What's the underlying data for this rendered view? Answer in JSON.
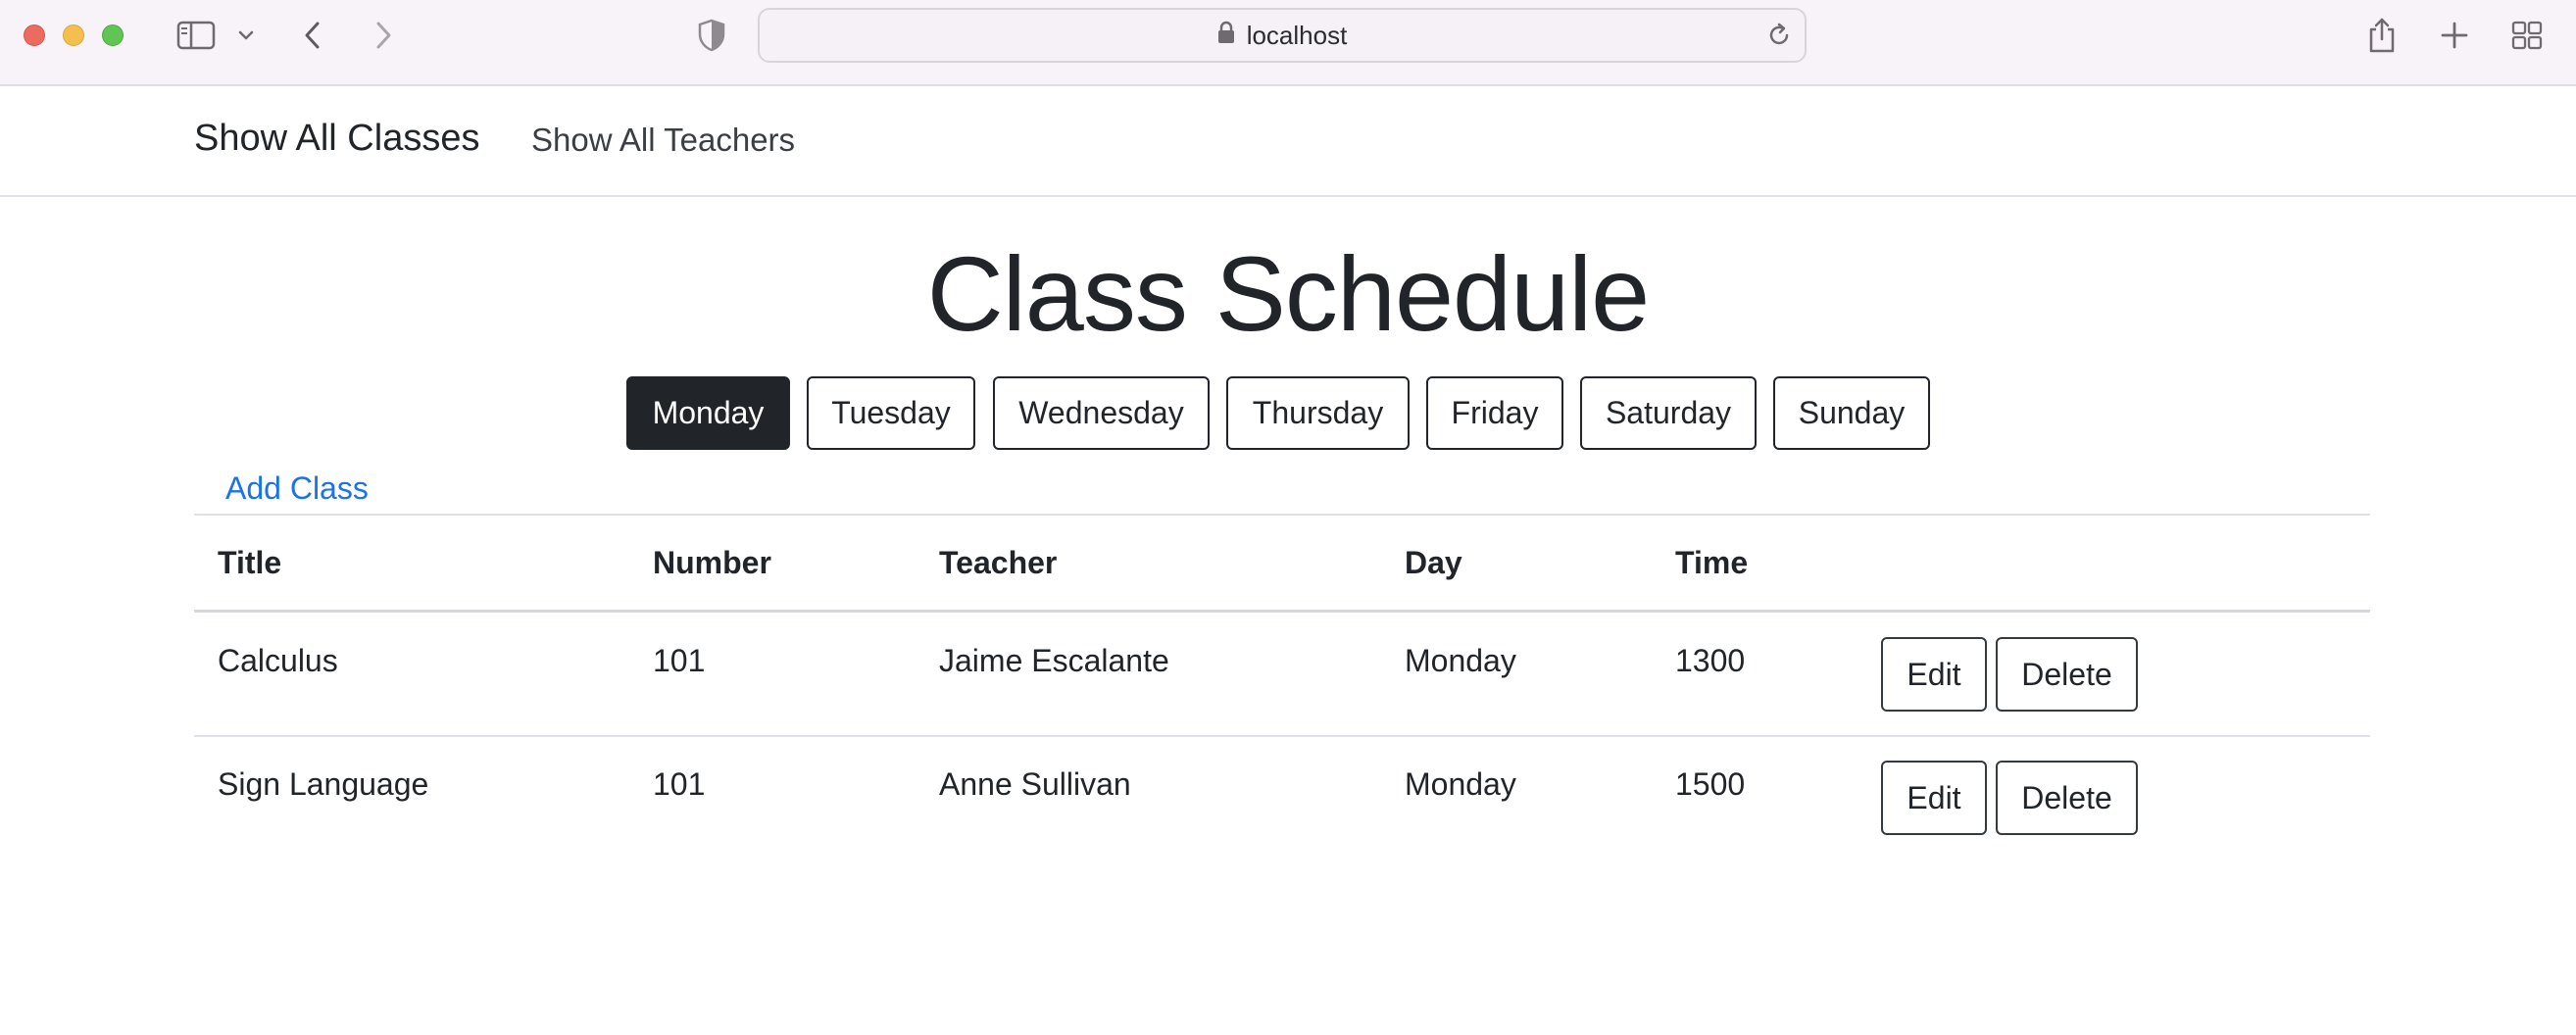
{
  "browser": {
    "url": "localhost",
    "icons": [
      "sidebar-icon",
      "chevron-down-icon",
      "back-icon",
      "forward-icon",
      "shield-icon",
      "lock-icon",
      "reload-icon",
      "share-icon",
      "new-tab-icon",
      "tab-overview-icon"
    ]
  },
  "navbar": {
    "brand": "Show All Classes",
    "link": "Show All Teachers"
  },
  "main": {
    "title": "Class Schedule",
    "days": [
      "Monday",
      "Tuesday",
      "Wednesday",
      "Thursday",
      "Friday",
      "Saturday",
      "Sunday"
    ],
    "active_day": "Monday",
    "add_class": "Add Class"
  },
  "table": {
    "headers": [
      "Title",
      "Number",
      "Teacher",
      "Day",
      "Time"
    ],
    "rows": [
      {
        "title": "Calculus",
        "number": "101",
        "teacher": "Jaime Escalante",
        "day": "Monday",
        "time": "1300",
        "edit": "Edit",
        "delete": "Delete"
      },
      {
        "title": "Sign Language",
        "number": "101",
        "teacher": "Anne Sullivan",
        "day": "Monday",
        "time": "1500",
        "edit": "Edit",
        "delete": "Delete"
      }
    ]
  },
  "colors": {
    "dark": "#212529",
    "link_blue": "#1a73e8",
    "chrome_bg": "#f8f3f9"
  }
}
